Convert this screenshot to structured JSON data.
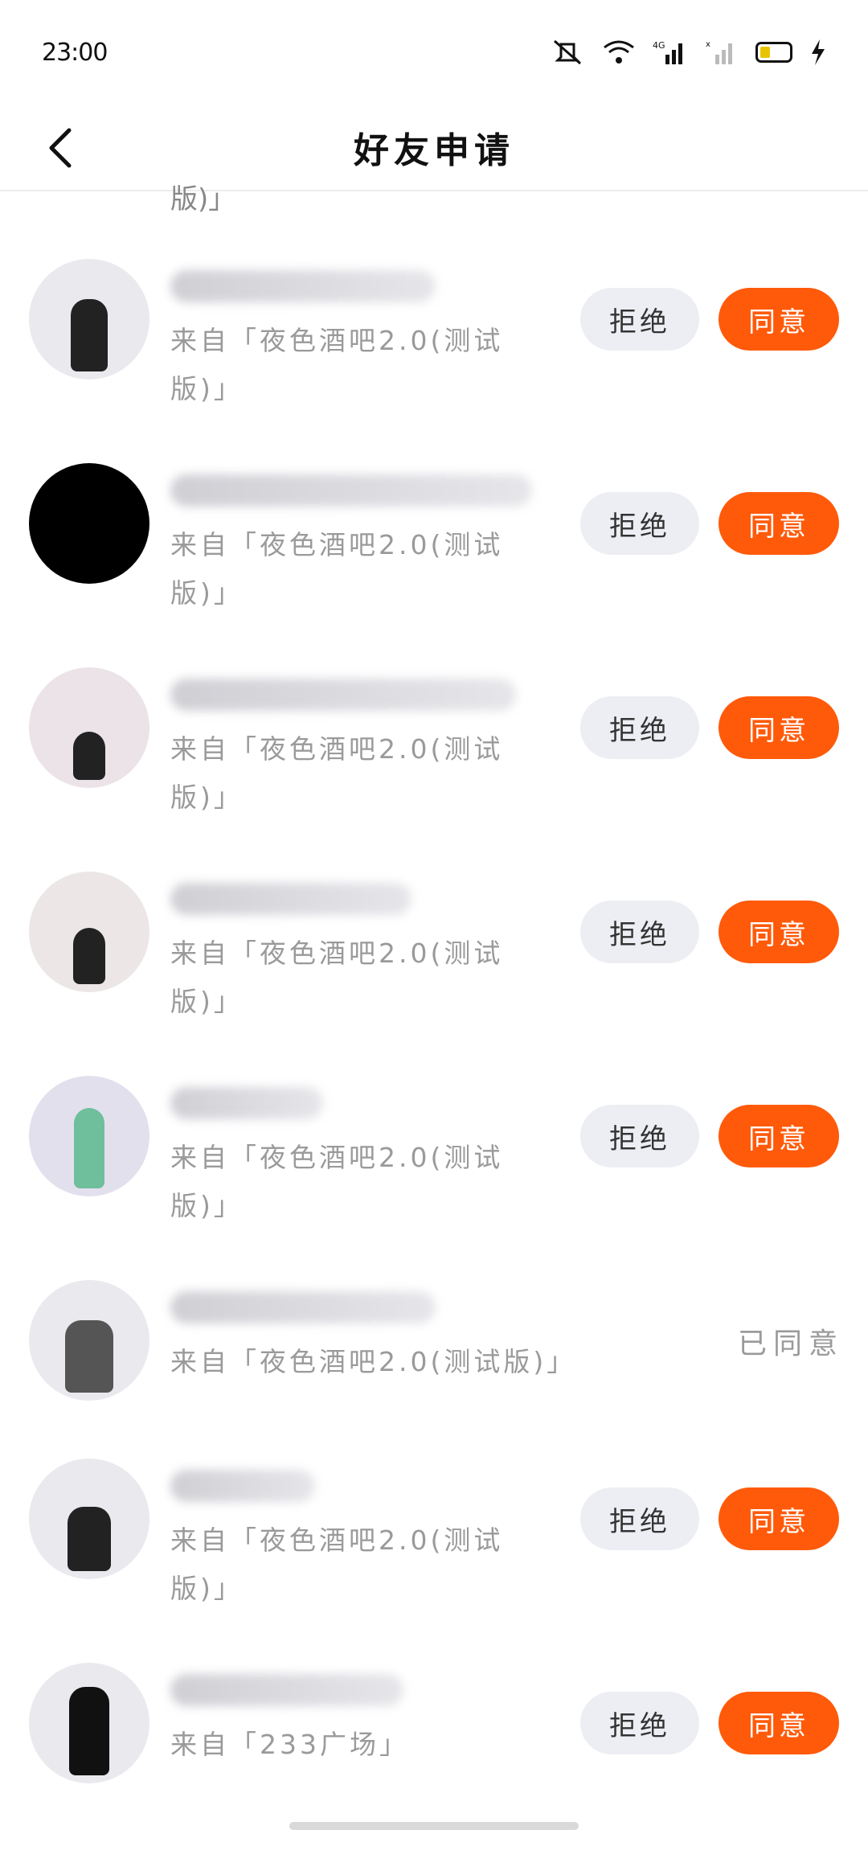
{
  "status_bar": {
    "time": "23:00",
    "icons": [
      "silent-icon",
      "wifi-icon",
      "signal-4g-icon",
      "signal-no-sim-icon",
      "battery-icon",
      "charging-icon"
    ],
    "network_label": "4G"
  },
  "header": {
    "title": "好友申请",
    "back_icon": "chevron-left-icon"
  },
  "partial_top_text": "版)」",
  "requests": [
    {
      "source": "来自「夜色酒吧2.0(测试版)」",
      "state": "pending",
      "reject_label": "拒绝",
      "accept_label": "同意"
    },
    {
      "source": "来自「夜色酒吧2.0(测试版)」",
      "state": "pending",
      "reject_label": "拒绝",
      "accept_label": "同意"
    },
    {
      "source": "来自「夜色酒吧2.0(测试版)」",
      "state": "pending",
      "reject_label": "拒绝",
      "accept_label": "同意"
    },
    {
      "source": "来自「夜色酒吧2.0(测试版)」",
      "state": "pending",
      "reject_label": "拒绝",
      "accept_label": "同意"
    },
    {
      "source": "来自「夜色酒吧2.0(测试版)」",
      "state": "pending",
      "reject_label": "拒绝",
      "accept_label": "同意"
    },
    {
      "source": "来自「夜色酒吧2.0(测试版)」",
      "state": "accepted",
      "accepted_label": "已同意"
    },
    {
      "source": "来自「夜色酒吧2.0(测试版)」",
      "state": "pending",
      "reject_label": "拒绝",
      "accept_label": "同意"
    },
    {
      "source": "来自「233广场」",
      "state": "pending",
      "reject_label": "拒绝",
      "accept_label": "同意"
    }
  ],
  "colors": {
    "accept": "#ff5a0a",
    "reject_bg": "#eceef3",
    "muted_text": "#9a9a9a"
  }
}
